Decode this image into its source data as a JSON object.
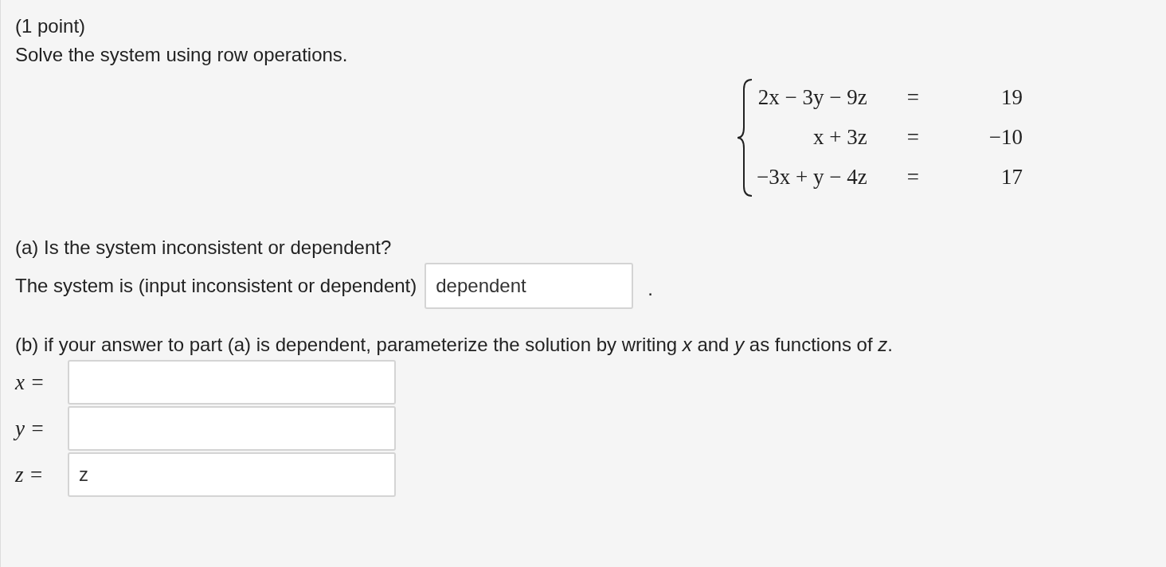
{
  "points": "(1 point)",
  "instruction": "Solve the system using row operations.",
  "system": [
    {
      "lhs": "2x − 3y − 9z",
      "rel": "=",
      "rhs": "19"
    },
    {
      "lhs": "x + 3z",
      "rel": "=",
      "rhs": "−10"
    },
    {
      "lhs": "−3x + y − 4z",
      "rel": "=",
      "rhs": "17"
    }
  ],
  "part_a": {
    "question": "(a) Is the system inconsistent or dependent?",
    "prompt": "The system is (input inconsistent or dependent)",
    "answer": {
      "value": "dependent"
    },
    "suffix": "."
  },
  "part_b": {
    "question": "(b) if your answer to part (a) is dependent, parameterize the solution by writing *x* and *y* as functions of *z*.",
    "answers": [
      {
        "label": "x ="
      },
      {
        "label": "y ="
      },
      {
        "label": "z =",
        "value": "z"
      }
    ]
  }
}
